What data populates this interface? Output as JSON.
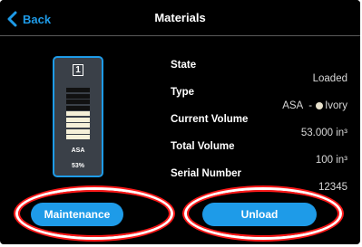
{
  "header": {
    "back_label": "Back",
    "title": "Materials"
  },
  "cartridge": {
    "bay_number": "1",
    "material": "ASA",
    "percent_label": "53%",
    "fill_level": 0.53,
    "fill_color": "#f5f0d8",
    "empty_color": "#111111",
    "border_color": "#1e9be8"
  },
  "info": {
    "state_label": "State",
    "state_value": "Loaded",
    "type_label": "Type",
    "type_material": "ASA",
    "type_separator": "-",
    "type_color_name": "Ivory",
    "current_volume_label": "Current Volume",
    "current_volume_value": "53.000 in³",
    "total_volume_label": "Total Volume",
    "total_volume_value": "100 in³",
    "serial_number_label": "Serial Number",
    "serial_number_value": "12345"
  },
  "buttons": {
    "maintenance_label": "Maintenance",
    "unload_label": "Unload"
  },
  "colors": {
    "accent": "#1e9be8",
    "background": "#000000",
    "highlight": "#ff1a1a"
  }
}
